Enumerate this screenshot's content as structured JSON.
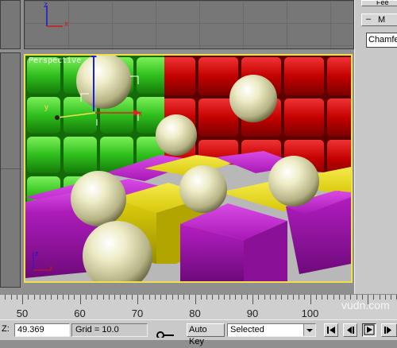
{
  "viewports": {
    "perspective_label": "Perspective",
    "top_axis_z": "z",
    "top_axis_x": "x",
    "gizmo_axis_y": "y",
    "gizmo_axis_x": "x",
    "corner_axis_z": "z",
    "corner_axis_x": "x"
  },
  "command_panel": {
    "top_button_label": "Fee",
    "modifier_minus": "–",
    "modifier_label": "M",
    "modifier_name": "Chamfe"
  },
  "timeline": {
    "ticks": [
      "50",
      "60",
      "70",
      "80",
      "90",
      "100"
    ]
  },
  "status_bar": {
    "z_label": "Z:",
    "z_value": "49.369",
    "grid_label": "Grid = 10.0",
    "auto_key_label": "Auto Key",
    "selection_value": "Selected"
  },
  "watermark": "vudn.com",
  "colors": {
    "viewport_active_border": "#f2e04a",
    "green_wall": "#2fbf1c",
    "red_wall": "#c40000",
    "purple_cube": "#b61ec4",
    "yellow_cube": "#e0d10c",
    "sphere": "#e6e4b4"
  }
}
